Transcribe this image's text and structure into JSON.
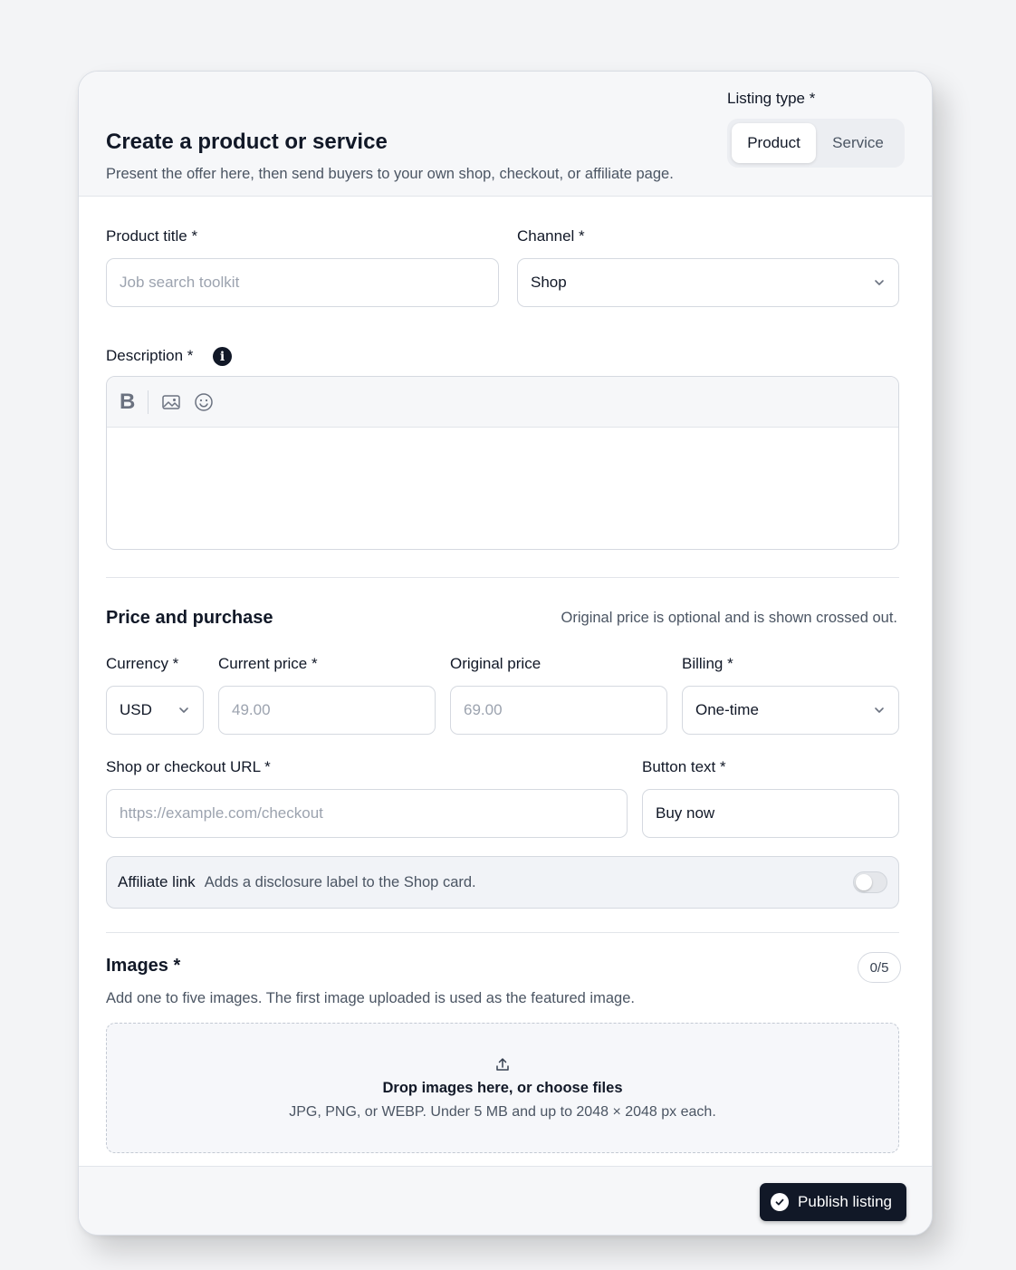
{
  "header": {
    "title": "Create a product or service",
    "subtitle": "Present the offer here, then send buyers to your own shop, checkout, or affiliate page.",
    "listing_type_label": "Listing type *",
    "listing_types": [
      {
        "label": "Product",
        "selected": true
      },
      {
        "label": "Service",
        "selected": false
      }
    ]
  },
  "form": {
    "product_title": {
      "label": "Product title *",
      "placeholder": "Job search toolkit",
      "value": ""
    },
    "channel": {
      "label": "Channel *",
      "value": "Shop"
    },
    "description": {
      "label": "Description *",
      "info_icon": "info-icon",
      "value": ""
    },
    "editor_toolbar": [
      {
        "name": "bold",
        "label": "B"
      },
      {
        "name": "image-icon"
      },
      {
        "name": "emoji-icon"
      }
    ]
  },
  "price": {
    "section_title": "Price and purchase",
    "hint": "Original price is optional and is shown crossed out.",
    "currency": {
      "label": "Currency *",
      "value": "USD"
    },
    "current_price": {
      "label": "Current price *",
      "placeholder": "49.00"
    },
    "original_price": {
      "label": "Original price",
      "placeholder": "69.00"
    },
    "billing": {
      "label": "Billing *",
      "value": "One-time"
    },
    "checkout_url": {
      "label": "Shop or checkout URL *",
      "placeholder": "https://example.com/checkout"
    },
    "button_text": {
      "label": "Button text *",
      "value": "Buy now"
    },
    "affiliate": {
      "title": "Affiliate link",
      "description": "Adds a disclosure label to the Shop card.",
      "enabled": false
    }
  },
  "images": {
    "section_title": "Images *",
    "hint": "Add one to five images. The first image uploaded is used as the featured image.",
    "counter": "0/5",
    "dropzone_title": "Drop images here, or choose files",
    "dropzone_desc": "JPG, PNG, or WEBP. Under 5 MB and up to 2048 × 2048 px each."
  },
  "footer": {
    "publish_label": "Publish listing"
  }
}
